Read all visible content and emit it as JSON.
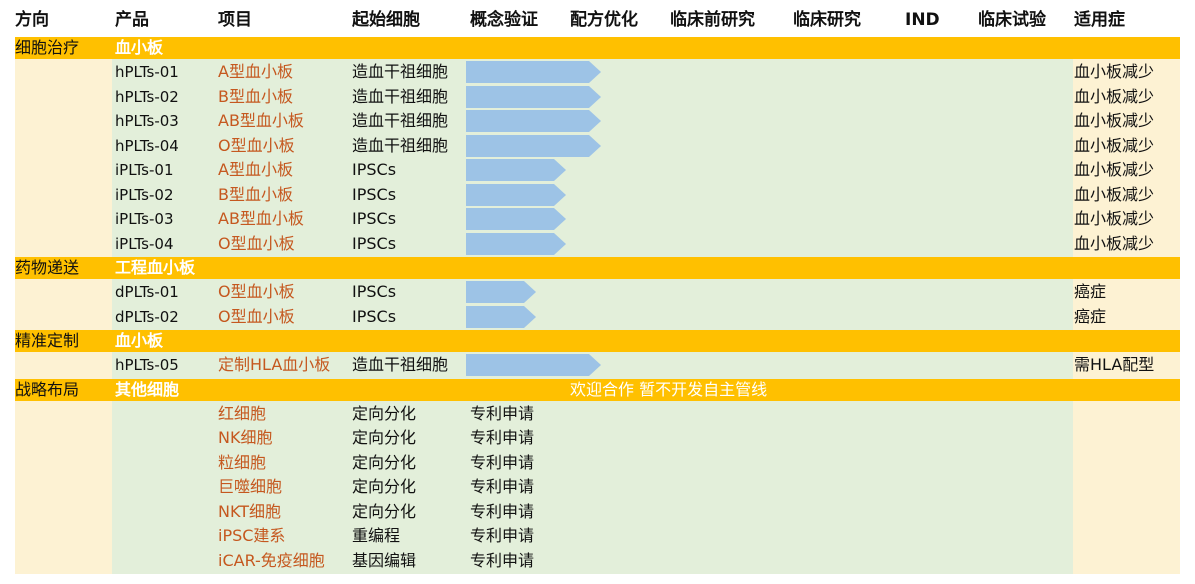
{
  "headers": [
    "方向",
    "产品",
    "项目",
    "起始细胞",
    "概念验证",
    "配方优化",
    "临床前研究",
    "临床研究",
    "IND",
    "临床试验",
    "适用症"
  ],
  "sections": [
    {
      "direction": "细胞治疗",
      "category": "血小板",
      "note": "",
      "rows": [
        {
          "product": "hPLTs-01",
          "project": "A型血小板",
          "cell": "造血干祖细胞",
          "stage_text": "",
          "indication": "血小板减少",
          "progress": 1.2
        },
        {
          "product": "hPLTs-02",
          "project": "B型血小板",
          "cell": "造血干祖细胞",
          "stage_text": "",
          "indication": "血小板减少",
          "progress": 1.2
        },
        {
          "product": "hPLTs-03",
          "project": "AB型血小板",
          "cell": "造血干祖细胞",
          "stage_text": "",
          "indication": "血小板减少",
          "progress": 1.2
        },
        {
          "product": "hPLTs-04",
          "project": "O型血小板",
          "cell": "造血干祖细胞",
          "stage_text": "",
          "indication": "血小板减少",
          "progress": 1.2
        },
        {
          "product": "iPLTs-01",
          "project": "A型血小板",
          "cell": "IPSCs",
          "stage_text": "",
          "indication": "血小板减少",
          "progress": 0.85
        },
        {
          "product": "iPLTs-02",
          "project": "B型血小板",
          "cell": "IPSCs",
          "stage_text": "",
          "indication": "血小板减少",
          "progress": 0.85
        },
        {
          "product": "iPLTs-03",
          "project": "AB型血小板",
          "cell": "IPSCs",
          "stage_text": "",
          "indication": "血小板减少",
          "progress": 0.85
        },
        {
          "product": "iPLTs-04",
          "project": "O型血小板",
          "cell": "IPSCs",
          "stage_text": "",
          "indication": "血小板减少",
          "progress": 0.85
        }
      ]
    },
    {
      "direction": "药物递送",
      "category": "工程血小板",
      "note": "",
      "rows": [
        {
          "product": "dPLTs-01",
          "project": "O型血小板",
          "cell": "IPSCs",
          "stage_text": "",
          "indication": "癌症",
          "progress": 0.55
        },
        {
          "product": "dPLTs-02",
          "project": "O型血小板",
          "cell": "IPSCs",
          "stage_text": "",
          "indication": "癌症",
          "progress": 0.55
        }
      ]
    },
    {
      "direction": "精准定制",
      "category": "血小板",
      "note": "",
      "rows": [
        {
          "product": "hPLTs-05",
          "project": "定制HLA血小板",
          "cell": "造血干祖细胞",
          "stage_text": "",
          "indication": "需HLA配型",
          "progress": 1.2
        }
      ]
    },
    {
      "direction": "战略布局",
      "category": "其他细胞",
      "note": "欢迎合作   暂不开发自主管线",
      "rows": [
        {
          "product": "",
          "project": "红细胞",
          "cell": "定向分化",
          "stage_text": "专利申请",
          "indication": "",
          "progress": 0
        },
        {
          "product": "",
          "project": "NK细胞",
          "cell": "定向分化",
          "stage_text": "专利申请",
          "indication": "",
          "progress": 0
        },
        {
          "product": "",
          "project": "粒细胞",
          "cell": "定向分化",
          "stage_text": "专利申请",
          "indication": "",
          "progress": 0
        },
        {
          "product": "",
          "project": "巨噬细胞",
          "cell": "定向分化",
          "stage_text": "专利申请",
          "indication": "",
          "progress": 0
        },
        {
          "product": "",
          "project": "NKT细胞",
          "cell": "定向分化",
          "stage_text": "专利申请",
          "indication": "",
          "progress": 0
        },
        {
          "product": "",
          "project": "iPSC建系",
          "cell": "重编程",
          "stage_text": "专利申请",
          "indication": "",
          "progress": 0
        },
        {
          "product": "",
          "project": "iCAR-免疫细胞",
          "cell": "基因编辑",
          "stage_text": "专利申请",
          "indication": "",
          "progress": 0
        }
      ]
    }
  ],
  "colors": {
    "section_bar": "#ffc000",
    "left_column": "#fdf2d3",
    "body_fill": "#e3efda",
    "right_column": "#fdf2d3",
    "arrow": "#9dc3e6",
    "project_text": "#c5581f"
  }
}
